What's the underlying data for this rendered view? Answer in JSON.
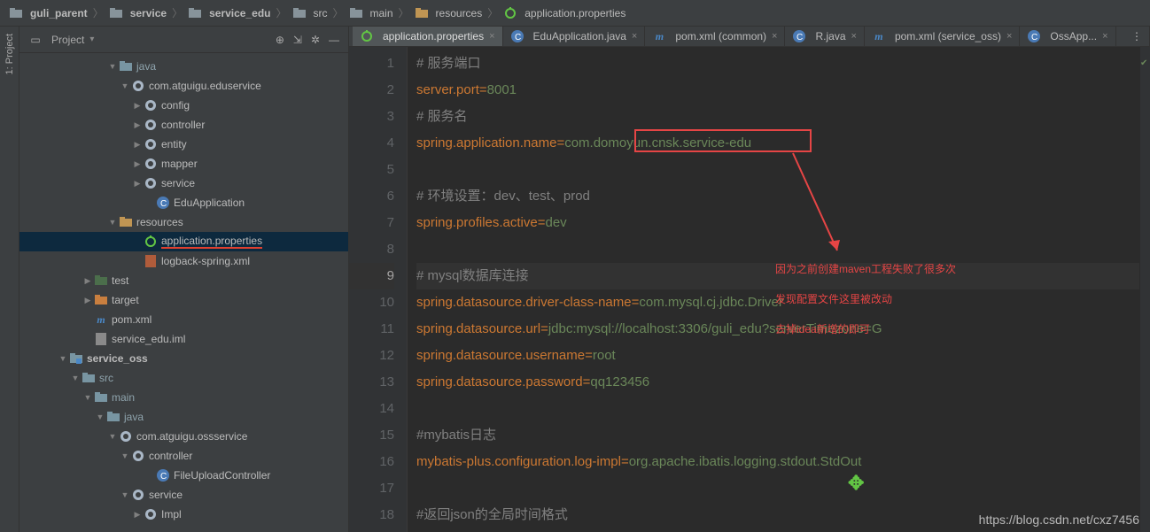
{
  "breadcrumbs": [
    "guli_parent",
    "service",
    "service_edu",
    "src",
    "main",
    "resources",
    "application.properties"
  ],
  "project_label": "Project",
  "tree": [
    {
      "d": 7,
      "a": "down",
      "k": "dir",
      "t": "java",
      "c": "#8fa4ad"
    },
    {
      "d": 8,
      "a": "down",
      "k": "pkg",
      "t": "com.atguigu.eduservice"
    },
    {
      "d": 9,
      "a": "right",
      "k": "pkg",
      "t": "config"
    },
    {
      "d": 9,
      "a": "right",
      "k": "pkg",
      "t": "controller"
    },
    {
      "d": 9,
      "a": "right",
      "k": "pkg",
      "t": "entity"
    },
    {
      "d": 9,
      "a": "right",
      "k": "pkg",
      "t": "mapper"
    },
    {
      "d": 9,
      "a": "right",
      "k": "pkg",
      "t": "service"
    },
    {
      "d": 10,
      "a": "",
      "k": "class",
      "t": "EduApplication"
    },
    {
      "d": 7,
      "a": "down",
      "k": "res",
      "t": "resources"
    },
    {
      "d": 9,
      "a": "",
      "k": "prop",
      "t": "application.properties",
      "sel": true,
      "ul": true
    },
    {
      "d": 9,
      "a": "",
      "k": "xml",
      "t": "logback-spring.xml"
    },
    {
      "d": 5,
      "a": "right",
      "k": "dir-x",
      "t": "test"
    },
    {
      "d": 5,
      "a": "right",
      "k": "dir-t",
      "t": "target"
    },
    {
      "d": 5,
      "a": "",
      "k": "mvn",
      "t": "pom.xml"
    },
    {
      "d": 5,
      "a": "",
      "k": "iml",
      "t": "service_edu.iml"
    },
    {
      "d": 3,
      "a": "down",
      "k": "mod",
      "t": "service_oss",
      "bold": true
    },
    {
      "d": 4,
      "a": "down",
      "k": "dir",
      "t": "src",
      "c": "#8fa4ad"
    },
    {
      "d": 5,
      "a": "down",
      "k": "dir",
      "t": "main",
      "c": "#8fa4ad"
    },
    {
      "d": 6,
      "a": "down",
      "k": "dir",
      "t": "java",
      "c": "#8fa4ad"
    },
    {
      "d": 7,
      "a": "down",
      "k": "pkg",
      "t": "com.atguigu.ossservice"
    },
    {
      "d": 8,
      "a": "down",
      "k": "pkg",
      "t": "controller"
    },
    {
      "d": 10,
      "a": "",
      "k": "class",
      "t": "FileUploadController"
    },
    {
      "d": 8,
      "a": "down",
      "k": "pkg",
      "t": "service"
    },
    {
      "d": 9,
      "a": "right",
      "k": "pkg",
      "t": "Impl"
    }
  ],
  "tabs": [
    {
      "ico": "prop",
      "label": "application.properties",
      "active": true
    },
    {
      "ico": "class",
      "label": "EduApplication.java"
    },
    {
      "ico": "mvn",
      "label": "pom.xml (common)"
    },
    {
      "ico": "class",
      "label": "R.java"
    },
    {
      "ico": "mvn",
      "label": "pom.xml (service_oss)"
    },
    {
      "ico": "class",
      "label": "OssApp..."
    }
  ],
  "code": {
    "lines": [
      {
        "seg": [
          {
            "c": "cm",
            "t": "# 服务端口"
          }
        ]
      },
      {
        "seg": [
          {
            "c": "key",
            "t": "server.port"
          },
          {
            "c": "eq",
            "t": "="
          },
          {
            "c": "val",
            "t": "8001"
          }
        ]
      },
      {
        "seg": [
          {
            "c": "cm",
            "t": "# 服务名"
          }
        ]
      },
      {
        "seg": [
          {
            "c": "key",
            "t": "spring.application.name"
          },
          {
            "c": "eq",
            "t": "="
          },
          {
            "c": "val",
            "t": "com.domoyun.cnsk.service-edu"
          }
        ]
      },
      {
        "seg": []
      },
      {
        "seg": [
          {
            "c": "cm",
            "t": "# 环境设置：dev、test、prod"
          }
        ]
      },
      {
        "seg": [
          {
            "c": "key",
            "t": "spring.profiles.active"
          },
          {
            "c": "eq",
            "t": "="
          },
          {
            "c": "val",
            "t": "dev"
          }
        ]
      },
      {
        "seg": []
      },
      {
        "seg": [
          {
            "c": "cm",
            "t": "# mysql数据库连接"
          }
        ],
        "cur": true
      },
      {
        "seg": [
          {
            "c": "key",
            "t": "spring.datasource.driver-class-name"
          },
          {
            "c": "eq",
            "t": "="
          },
          {
            "c": "val",
            "t": "com.mysql.cj.jdbc.Driver"
          }
        ]
      },
      {
        "seg": [
          {
            "c": "key",
            "t": "spring.datasource.url"
          },
          {
            "c": "eq",
            "t": "="
          },
          {
            "c": "val",
            "t": "jdbc:mysql://localhost:3306/guli_edu?serverTimezone=G"
          }
        ]
      },
      {
        "seg": [
          {
            "c": "key",
            "t": "spring.datasource.username"
          },
          {
            "c": "eq",
            "t": "="
          },
          {
            "c": "val",
            "t": "root"
          }
        ]
      },
      {
        "seg": [
          {
            "c": "key",
            "t": "spring.datasource.password"
          },
          {
            "c": "eq",
            "t": "="
          },
          {
            "c": "val",
            "t": "qq123456"
          }
        ]
      },
      {
        "seg": []
      },
      {
        "seg": [
          {
            "c": "cm",
            "t": "#mybatis日志"
          }
        ]
      },
      {
        "seg": [
          {
            "c": "key",
            "t": "mybatis-plus.configuration.log-impl"
          },
          {
            "c": "eq",
            "t": "="
          },
          {
            "c": "val",
            "t": "org.apache.ibatis.logging.stdout.StdOut"
          }
        ]
      },
      {
        "seg": []
      },
      {
        "seg": [
          {
            "c": "cm",
            "t": "#返回json的全局时间格式"
          }
        ]
      }
    ]
  },
  "annotations": {
    "box_line": 4,
    "note1": "因为之前创建maven工程失败了很多次",
    "note2": "发现配置文件这里被改动",
    "note3": "去掉idea新增的即可"
  },
  "watermark": "https://blog.csdn.net/cxz7456"
}
